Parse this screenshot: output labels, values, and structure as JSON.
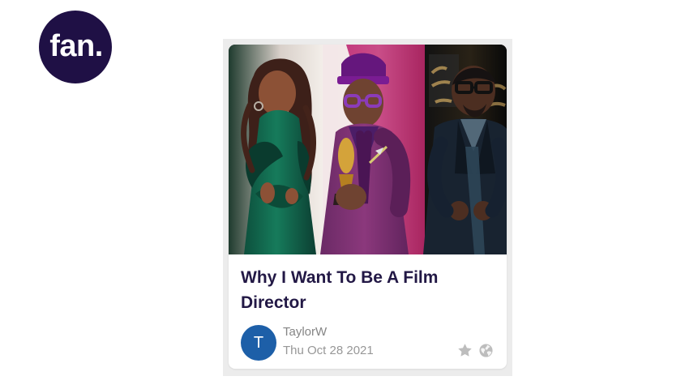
{
  "brand": {
    "logo_text": "fan.",
    "logo_color": "#1f1045",
    "logo_text_color": "#ffffff"
  },
  "card": {
    "title": "Why I Want To Be A Film Director",
    "author": "TaylorW",
    "author_initial": "T",
    "date": "Thu Oct 28 2021",
    "avatar_color": "#1d5fa8",
    "title_color": "#221845",
    "meta_color": "#8f8f8f",
    "icons": {
      "star": "star-icon",
      "globe": "globe-icon"
    }
  }
}
